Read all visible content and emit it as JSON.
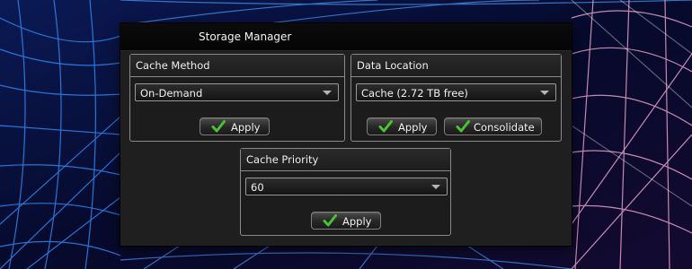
{
  "window": {
    "title": "Storage Manager"
  },
  "cache_method": {
    "title": "Cache Method",
    "selected": "On-Demand",
    "apply_label": "Apply"
  },
  "data_location": {
    "title": "Data Location",
    "selected": "Cache (2.72 TB free)",
    "apply_label": "Apply",
    "consolidate_label": "Consolidate"
  },
  "cache_priority": {
    "title": "Cache Priority",
    "selected": "60",
    "apply_label": "Apply"
  },
  "icons": {
    "check": "check-icon",
    "dropdown": "chevron-down-icon"
  },
  "colors": {
    "check_green": "#49c430",
    "panel_bg": "#1c1c1c",
    "border": "#8a8a8a"
  }
}
